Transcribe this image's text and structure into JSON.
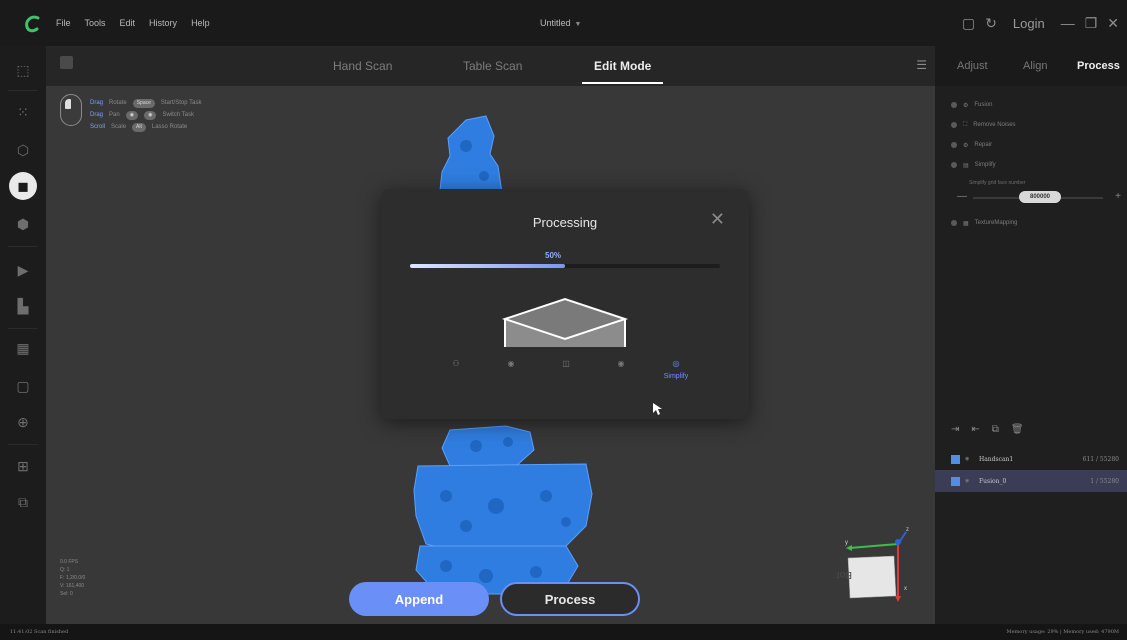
{
  "app": {
    "menu": [
      "File",
      "Tools",
      "Edit",
      "History",
      "Help"
    ],
    "doc_title": "Untitled",
    "login_label": "Login"
  },
  "viewport": {
    "tabs": [
      "Hand Scan",
      "Table Scan",
      "Edit Mode"
    ],
    "active_tab": "Edit Mode",
    "hints": [
      {
        "key": "Drag",
        "action": "Rotate",
        "kbd": "Space",
        "desc": "Start/Stop Task"
      },
      {
        "key": "Drag",
        "action": "Pan",
        "kbd": "",
        "desc": "Switch Task"
      },
      {
        "key": "Scroll",
        "action": "Scale",
        "kbd": "Alt",
        "desc": "Lasso Rotate"
      }
    ],
    "stats": [
      "0.0 FPS",
      "",
      "Q: 1",
      "F: 1,2/0,0/0",
      "V: 161,400",
      "Sel: 0"
    ]
  },
  "gizmo": {
    "face_label": "Bottom",
    "axes": [
      "y",
      "z",
      "x"
    ]
  },
  "dialog": {
    "title": "Processing",
    "percent_label": "50%",
    "progress": 0.5,
    "steps": [
      {
        "icon": "fusion-icon",
        "label": ""
      },
      {
        "icon": "remove-noises-icon",
        "label": ""
      },
      {
        "icon": "repair-icon",
        "label": ""
      },
      {
        "icon": "simplify-icon",
        "label": ""
      },
      {
        "icon": "texture-icon",
        "label": "Simplify"
      }
    ]
  },
  "buttons": {
    "append": "Append",
    "process": "Process"
  },
  "right_panel": {
    "tabs": [
      "Adjust",
      "Align",
      "Process"
    ],
    "active_tab": "Process",
    "items": [
      "Fusion",
      "Remove Noises",
      "Repair",
      "Simplify",
      "TextureMapping"
    ],
    "simplify_sub_label": "Simplify grid face number",
    "simplify_value": "800000",
    "layers": [
      {
        "name": "Handscan1",
        "count": "611 / 55280"
      },
      {
        "name": "Fusion_0",
        "count": "1 / 55280"
      }
    ]
  },
  "statusbar": {
    "left": "11:41:02 Scan finished",
    "right": "Memory usage: 29% | Memory used: 4790M"
  }
}
